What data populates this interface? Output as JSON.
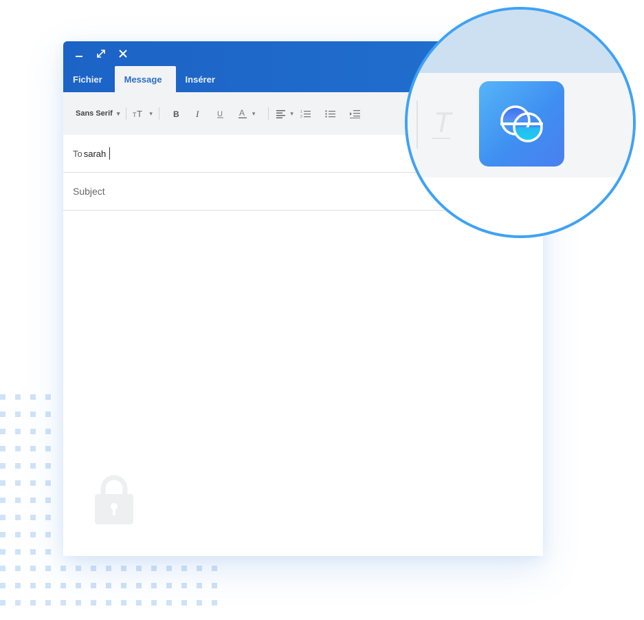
{
  "window": {
    "controls": [
      "minimize-icon",
      "expand-icon",
      "close-icon"
    ],
    "tabs": [
      {
        "label": "Fichier"
      },
      {
        "label": "Message",
        "active": true
      },
      {
        "label": "Insérer"
      }
    ]
  },
  "toolbar": {
    "font_family": "Sans Serif",
    "icons": [
      "font-size-icon",
      "bold-icon",
      "italic-icon",
      "underline-icon",
      "text-color-icon",
      "align-icon",
      "numbered-list-icon",
      "bullet-list-icon",
      "indent-icon",
      "clear-format-icon"
    ]
  },
  "compose": {
    "to_label": "To",
    "to_value": "sarah",
    "subject_placeholder": "Subject"
  },
  "colors": {
    "titlebar": "#1c63c6",
    "accent": "#2a6ec7",
    "magnifier_ring": "#3fa2f4",
    "app_icon": "#3f8ff1"
  }
}
